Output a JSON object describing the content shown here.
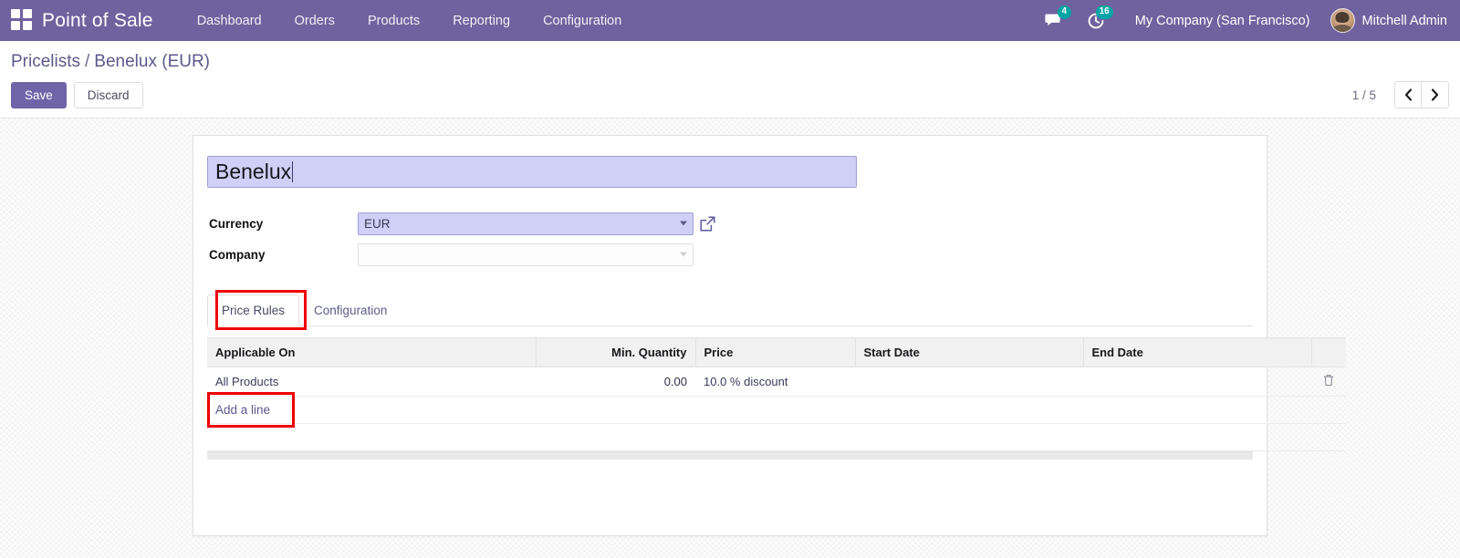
{
  "navbar": {
    "apps_icon": "apps-grid-icon",
    "brand": "Point of Sale",
    "menu": [
      {
        "label": "Dashboard"
      },
      {
        "label": "Orders"
      },
      {
        "label": "Products"
      },
      {
        "label": "Reporting"
      },
      {
        "label": "Configuration"
      }
    ],
    "messages_icon": "chat-bubble-icon",
    "messages_count": "4",
    "activity_icon": "clock-activity-icon",
    "activity_count": "16",
    "company": "My Company (San Francisco)",
    "avatar_icon": "user-avatar",
    "user": "Mitchell Admin",
    "bg_color": "#6f629e",
    "badge_color": "#00a4a6"
  },
  "control_panel": {
    "breadcrumb": {
      "parent": "Pricelists",
      "separator": "/",
      "current": "Benelux (EUR)"
    },
    "save_label": "Save",
    "discard_label": "Discard",
    "pager": {
      "count": "1 / 5",
      "prev_icon": "chevron-left-icon",
      "next_icon": "chevron-right-icon"
    },
    "save_color": "#7064a8"
  },
  "form": {
    "title_value": "Benelux",
    "title_placeholder": "e.g. Wholesalers",
    "dirty_field_color": "#cfcff8",
    "fields": [
      {
        "label": "Currency",
        "value": "EUR",
        "placeholder": "",
        "state": "filled",
        "has_external_link": true,
        "external_link_icon": "external-link-icon",
        "caret_icon": "chevron-down-icon"
      },
      {
        "label": "Company",
        "value": "",
        "placeholder": "",
        "state": "empty",
        "has_external_link": false,
        "caret_icon": "chevron-down-icon"
      }
    ]
  },
  "notebook": {
    "tabs": [
      {
        "label": "Price Rules",
        "active": true,
        "annotated": true
      },
      {
        "label": "Configuration",
        "active": false,
        "annotated": false
      }
    ]
  },
  "price_rules_table": {
    "columns": [
      {
        "label": "Applicable On",
        "align": "left"
      },
      {
        "label": "Min. Quantity",
        "align": "right"
      },
      {
        "label": "Price",
        "align": "left"
      },
      {
        "label": "Start Date",
        "align": "left"
      },
      {
        "label": "End Date",
        "align": "left"
      },
      {
        "label": "",
        "align": "center"
      }
    ],
    "rows": [
      {
        "applicable_on": "All Products",
        "min_quantity": "0.00",
        "price": "10.0 % discount",
        "start_date": "",
        "end_date": "",
        "delete_icon": "trash-icon"
      }
    ],
    "add_line_label": "Add a line",
    "add_line_annotated": true,
    "empty_rows": 1
  },
  "annotations": {
    "color": "#ee0000",
    "boxes": [
      {
        "target": "tab-price-rules"
      },
      {
        "target": "add-a-line-button"
      }
    ]
  }
}
